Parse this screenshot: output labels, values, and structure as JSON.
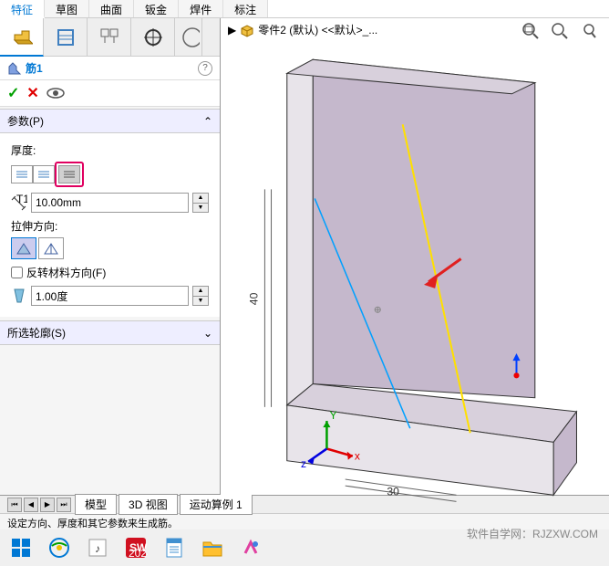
{
  "top_tabs": {
    "feature": "特征",
    "sketch": "草图",
    "surface": "曲面",
    "sheet_metal": "钣金",
    "weldments": "焊件",
    "annotate": "标注"
  },
  "feature_header": {
    "icon_name": "rib-icon",
    "title": "筋1"
  },
  "params": {
    "section_title": "参数(P)",
    "thickness_label": "厚度:",
    "thickness_value": "10.00mm",
    "extrude_dir_label": "拉伸方向:",
    "reverse_material_label": "反转材料方向(F)",
    "angle_value": "1.00度"
  },
  "selected_contour": {
    "section_title": "所选轮廓(S)"
  },
  "breadcrumb": {
    "part_label": "零件2 (默认) <<默认>_..."
  },
  "bottom_tabs": {
    "model": "模型",
    "view3d": "3D 视图",
    "motion": "运动算例 1"
  },
  "status_text": "设定方向、厚度和其它参数来生成筋。",
  "watermark_text": "软件自学网：RJZXW.COM",
  "dimensions": {
    "height": "40",
    "width": "30"
  },
  "colors": {
    "panel_bg": "#f5f5f5",
    "accent": "#0078d4",
    "model_face": "#c5b8cc",
    "highlight_border": "#e00060"
  }
}
